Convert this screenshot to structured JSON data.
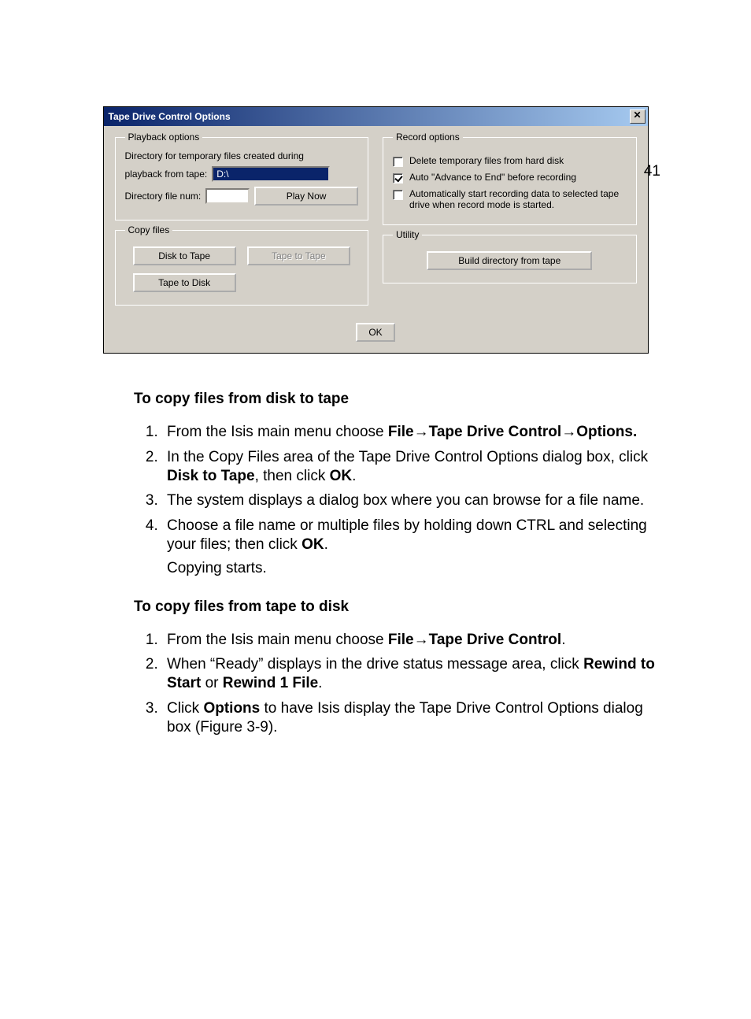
{
  "page_number": "41",
  "dialog": {
    "title": "Tape Drive Control Options",
    "close_glyph": "✕",
    "playback": {
      "legend": "Playback options",
      "dir_label_line1": "Directory for temporary files created during",
      "dir_label_line2": "playback from tape:",
      "dir_value": "D:\\",
      "num_label": "Directory file num:",
      "num_value": "",
      "play_now": "Play Now"
    },
    "copy": {
      "legend": "Copy files",
      "disk_to_tape": "Disk to Tape",
      "tape_to_tape": "Tape to Tape",
      "tape_to_disk": "Tape to Disk"
    },
    "record": {
      "legend": "Record options",
      "opt1": "Delete temporary files from hard disk",
      "opt1_checked": false,
      "opt2": "Auto \"Advance to End\" before recording",
      "opt2_checked": true,
      "opt3": "Automatically start recording data to selected tape drive when record mode is started.",
      "opt3_checked": false
    },
    "utility": {
      "legend": "Utility",
      "build": "Build directory from tape"
    },
    "ok": "OK"
  },
  "doc": {
    "section1_title": "To copy files from disk to tape",
    "s1_li1_a": "From the Isis main menu choose ",
    "s1_li1_b": "File",
    "s1_li1_c": "Tape Drive Control",
    "s1_li1_d": "Options.",
    "arrow": "→",
    "s1_li2_a": "In the Copy Files area of the Tape Drive Control Options dialog box, click ",
    "s1_li2_b": "Disk to Tape",
    "s1_li2_c": ", then click ",
    "s1_li2_d": "OK",
    "s1_li2_e": ".",
    "s1_li3": "The system displays a dialog box where you can browse for a file name.",
    "s1_li4_a": "Choose a file name or multiple files by holding down CTRL and selecting your files; then click ",
    "s1_li4_b": "OK",
    "s1_li4_c": ".",
    "s1_li4_follow": "Copying starts.",
    "section2_title": "To copy files from tape to disk",
    "s2_li1_a": "From the Isis main menu choose ",
    "s2_li1_b": "File",
    "s2_li1_c": "Tape Drive Control",
    "s2_li1_d": ".",
    "s2_li2_a": "When “Ready” displays in the drive status message area, click ",
    "s2_li2_b": "Rewind to Start",
    "s2_li2_c": " or ",
    "s2_li2_d": "Rewind 1 File",
    "s2_li2_e": ".",
    "s2_li3_a": "Click ",
    "s2_li3_b": "Options",
    "s2_li3_c": " to have Isis display the Tape Drive Control Options dialog box (Figure 3-9)."
  }
}
